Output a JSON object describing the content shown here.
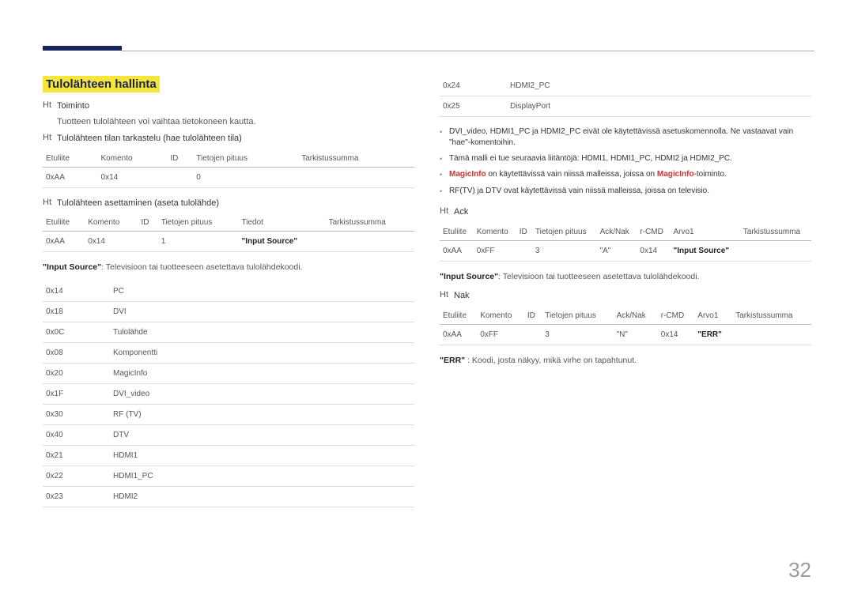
{
  "header": {
    "title": "Tulolähteen hallinta"
  },
  "left": {
    "func_label": "Ht",
    "func_text": "Toiminto",
    "func_desc": "Tuotteen tulolähteen voi vaihtaa tietokoneen kautta.",
    "view_label": "Ht",
    "view_text": "Tulolähteen tilan tarkastelu (hae tulolähteen tila)",
    "tbl1": {
      "h1": "Etuliite",
      "h2": "Komento",
      "h3": "ID",
      "h4": "Tietojen pituus",
      "h5": "Tarkistussumma",
      "r1c1": "0xAA",
      "r1c2": "0x14",
      "r1c3": "",
      "r1c4": "0",
      "r1c5": ""
    },
    "set_label": "Ht",
    "set_text": "Tulolähteen asettaminen (aseta tulolähde)",
    "tbl2": {
      "h1": "Etuliite",
      "h2": "Komento",
      "h3": "ID",
      "h4": "Tietojen pituus",
      "h5": "Tiedot",
      "h6": "Tarkistussumma",
      "r1c1": "0xAA",
      "r1c2": "0x14",
      "r1c3": "",
      "r1c4": "1",
      "r1c5": "\"Input Source\"",
      "r1c6": ""
    },
    "desc1_pre": "\"Input Source\"",
    "desc1_rest": ": Televisioon tai tuotteeseen asetettava tulolähdekoodi.",
    "tbl3": {
      "r0c1": "0x14",
      "r0c2": "PC",
      "r1c1": "0x18",
      "r1c2": "DVI",
      "r2c1": "0x0C",
      "r2c2": "Tulolähde",
      "r3c1": "0x08",
      "r3c2": "Komponentti",
      "r4c1": "0x20",
      "r4c2": "MagicInfo",
      "r5c1": "0x1F",
      "r5c2": "DVI_video",
      "r6c1": "0x30",
      "r6c2": "RF (TV)",
      "r7c1": "0x40",
      "r7c2": "DTV",
      "r8c1": "0x21",
      "r8c2": "HDMI1",
      "r9c1": "0x22",
      "r9c2": "HDMI1_PC",
      "r10c1": "0x23",
      "r10c2": "HDMI2"
    }
  },
  "right": {
    "tbl_top": {
      "r0c1": "0x24",
      "r0c2": "HDMI2_PC",
      "r1c1": "0x25",
      "r1c2": "DisplayPort"
    },
    "note1": "DVI_video, HDMI1_PC ja HDMI2_PC eivät ole käytettävissä asetuskomennolla. Ne vastaavat vain \"hae\"-komentoihin.",
    "note2": "Tämä malli ei tue seuraavia liitäntöjä: HDMI1, HDMI1_PC, HDMI2 ja HDMI2_PC.",
    "note3_a": "MagicInfo",
    "note3_b": " on käytettävissä vain niissä malleissa, joissa on ",
    "note3_c": "MagicInfo",
    "note3_d": "-toiminto.",
    "note4": "RF(TV) ja DTV ovat käytettävissä vain niissä malleissa, joissa on televisio.",
    "ack_label": "Ht",
    "ack_text": "Ack",
    "tbl_ack": {
      "h1": "Etuliite",
      "h2": "Komento",
      "h3": "ID",
      "h4": "Tietojen pituus",
      "h5": "Ack/Nak",
      "h6": "r-CMD",
      "h7": "Arvo1",
      "h8": "Tarkistussumma",
      "r1c1": "0xAA",
      "r1c2": "0xFF",
      "r1c3": "",
      "r1c4": "3",
      "r1c5": "\"A\"",
      "r1c6": "0x14",
      "r1c7": "\"Input Source\"",
      "r1c8": ""
    },
    "desc_ack_pre": "\"Input Source\"",
    "desc_ack_rest": ": Televisioon tai tuotteeseen asetettava tulolähdekoodi.",
    "nak_label": "Ht",
    "nak_text": "Nak",
    "tbl_nak": {
      "h1": "Etuliite",
      "h2": "Komento",
      "h3": "ID",
      "h4": "Tietojen pituus",
      "h5": "Ack/Nak",
      "h6": "r-CMD",
      "h7": "Arvo1",
      "h8": "Tarkistussumma",
      "r1c1": "0xAA",
      "r1c2": "0xFF",
      "r1c3": "",
      "r1c4": "3",
      "r1c5": "\"N\"",
      "r1c6": "0x14",
      "r1c7": "\"ERR\"",
      "r1c8": ""
    },
    "err_pre": "\"ERR\"",
    "err_rest": " : Koodi, josta näkyy, mikä virhe on tapahtunut."
  },
  "page_num": "32"
}
